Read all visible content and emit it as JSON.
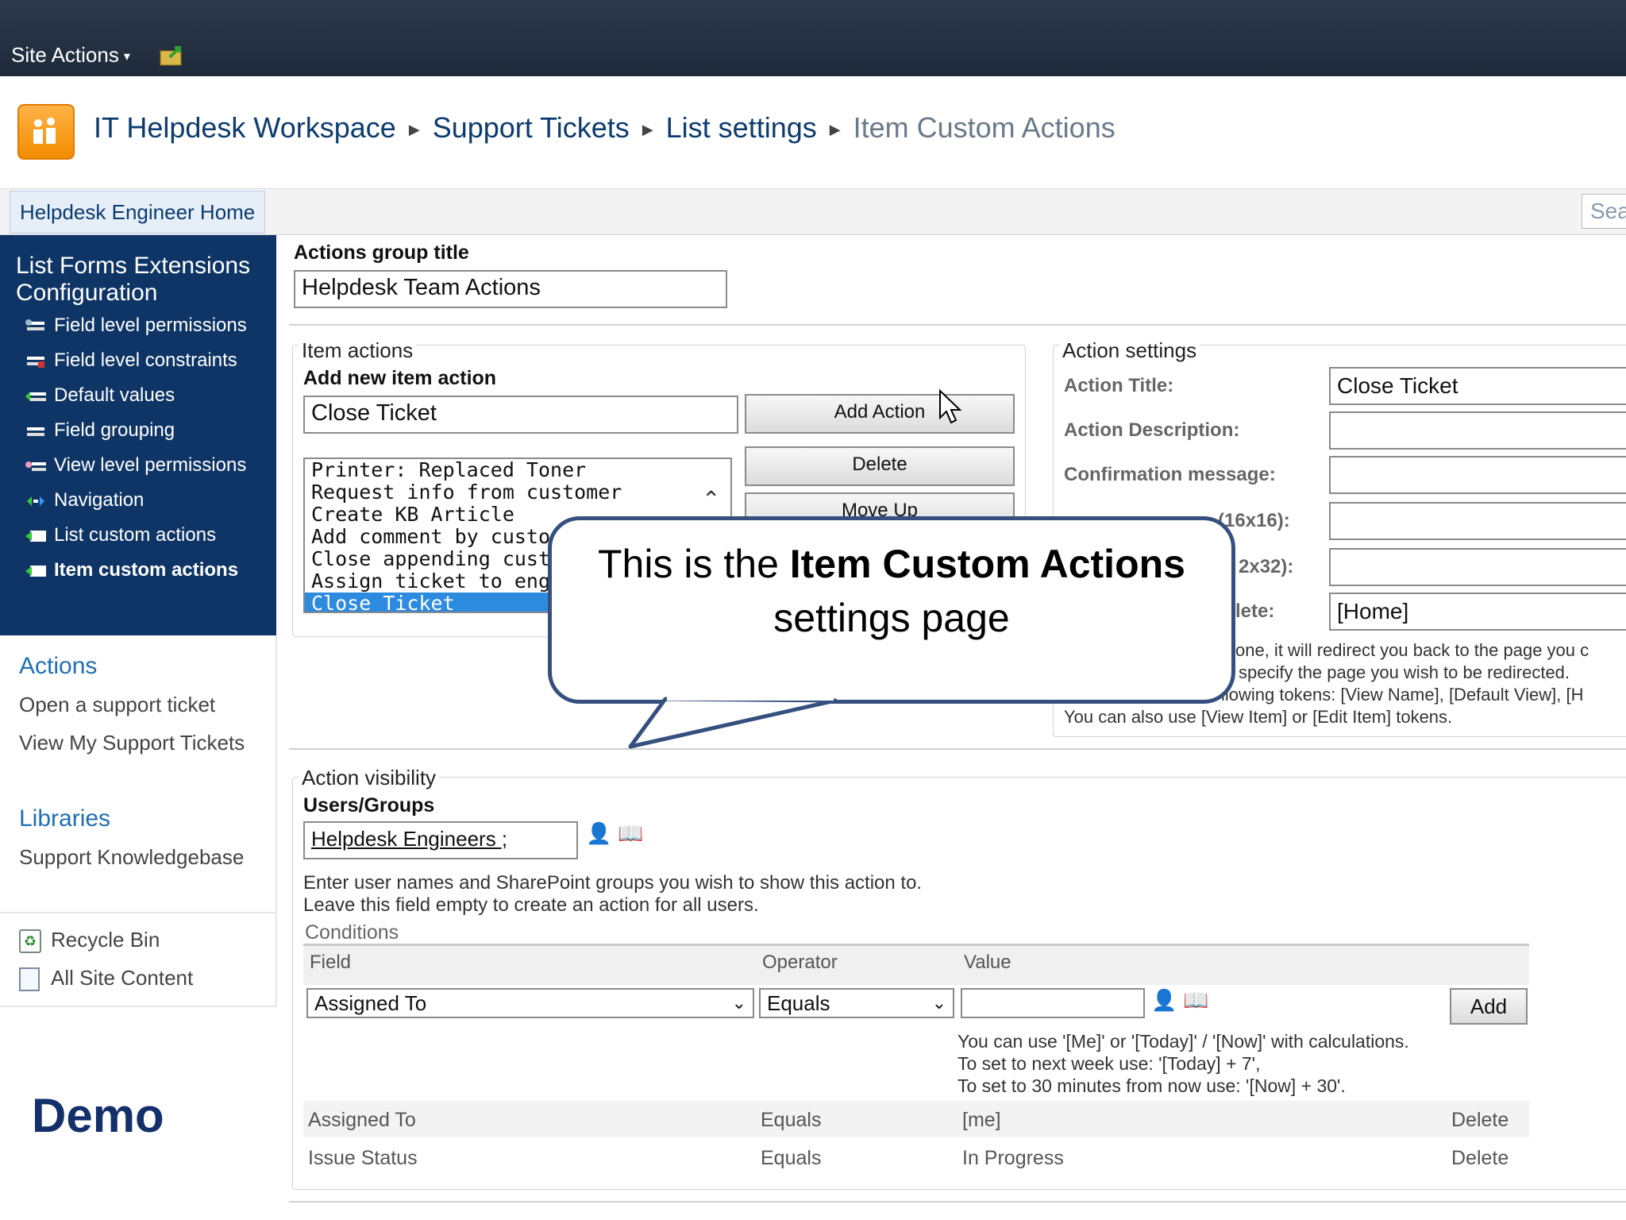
{
  "ribbon": {
    "site_actions": "Site Actions"
  },
  "breadcrumb": {
    "site": "IT Helpdesk Workspace",
    "list": "Support Tickets",
    "settings": "List settings",
    "current": "Item Custom Actions"
  },
  "topnav": {
    "home": "Helpdesk Engineer Home",
    "search_placeholder": "Sea"
  },
  "leftnav": {
    "title": "List Forms Extensions Configuration",
    "items": [
      {
        "label": "Field level permissions"
      },
      {
        "label": "Field level constraints"
      },
      {
        "label": "Default values"
      },
      {
        "label": "Field grouping"
      },
      {
        "label": "View level permissions"
      },
      {
        "label": "Navigation"
      },
      {
        "label": "List custom actions"
      },
      {
        "label": "Item custom actions"
      }
    ],
    "actions_heading": "Actions",
    "actions": [
      "Open a support ticket",
      "View My Support Tickets"
    ],
    "libraries_heading": "Libraries",
    "libraries": [
      "Support Knowledgebase"
    ],
    "recycle_bin": "Recycle Bin",
    "all_site_content": "All Site Content"
  },
  "demo_label": "Demo",
  "form": {
    "group_title_label": "Actions group title",
    "group_title_value": "Helpdesk Team Actions",
    "item_actions_legend": "Item actions",
    "add_new_label": "Add new item action",
    "new_action_value": "Close Ticket",
    "add_action_button": "Add Action",
    "delete_button": "Delete",
    "move_up_button": "Move Up",
    "items": [
      "Printer: Replaced Toner",
      "Request info from customer",
      "Create KB Article",
      "Add comment by custon",
      "Close appending custon",
      "Assign ticket to enginee",
      "Close Ticket"
    ],
    "action_settings_legend": "Action settings",
    "settings": {
      "title_label": "Action Title:",
      "title_value": "Close Ticket",
      "description_label": "Action Description:",
      "confirm_label": "Confirmation message:",
      "icon16_label": "(16x16):",
      "icon32_label": "2x32):",
      "redirect_label": "lete:",
      "redirect_value": "[Home]",
      "hint1": "one, it will redirect you back to the page you c",
      "hint2": "specify the page you wish to be redirected.",
      "hint3": "llowing tokens: [View Name], [Default View], [H",
      "hint4": "You can also use [View Item] or [Edit Item] tokens."
    },
    "visibility_legend": "Action visibility",
    "users_label": "Users/Groups",
    "users_value": "Helpdesk Engineers ;",
    "users_hint1": "Enter user names and SharePoint groups you wish to show this action to.",
    "users_hint2": "Leave this field empty to create an action for all users.",
    "conditions_label": "Conditions",
    "cond_headers": {
      "field": "Field",
      "operator": "Operator",
      "value": "Value"
    },
    "cond_field_select": "Assigned To",
    "cond_operator_select": "Equals",
    "cond_add_button": "Add",
    "cond_hint1": "You can use '[Me]' or '[Today]' / '[Now]' with calculations.",
    "cond_hint2": "To set to next week use: '[Today] + 7',",
    "cond_hint3": "To set to 30 minutes from now use: '[Now] + 30'.",
    "conditions": [
      {
        "field": "Assigned To",
        "operator": "Equals",
        "value": "[me]",
        "action": "Delete"
      },
      {
        "field": "Issue Status",
        "operator": "Equals",
        "value": "In Progress",
        "action": "Delete"
      }
    ]
  },
  "callout": {
    "pre": "This is the ",
    "bold": "Item Custom Actions",
    "post": "settings page"
  }
}
